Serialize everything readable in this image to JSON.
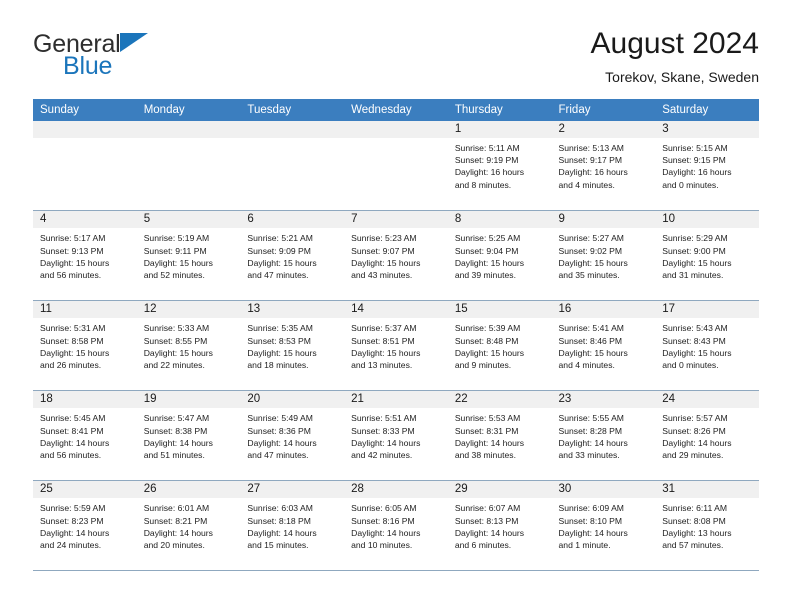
{
  "logo": {
    "line1": "General",
    "line2": "Blue",
    "triangle_color": "#1b75bb",
    "text_color": "#2e2e2e"
  },
  "header": {
    "title": "August 2024",
    "subtitle": "Torekov, Skane, Sweden"
  },
  "theme": {
    "header_bg": "#3b7ebf",
    "header_text": "#ffffff",
    "daynum_bg": "#f0f0f0",
    "cell_border": "#8fa8bf"
  },
  "weekdays": [
    "Sunday",
    "Monday",
    "Tuesday",
    "Wednesday",
    "Thursday",
    "Friday",
    "Saturday"
  ],
  "weeks": [
    [
      {
        "day": "",
        "lines": []
      },
      {
        "day": "",
        "lines": []
      },
      {
        "day": "",
        "lines": []
      },
      {
        "day": "",
        "lines": []
      },
      {
        "day": "1",
        "lines": [
          "Sunrise: 5:11 AM",
          "Sunset: 9:19 PM",
          "Daylight: 16 hours",
          "and 8 minutes."
        ]
      },
      {
        "day": "2",
        "lines": [
          "Sunrise: 5:13 AM",
          "Sunset: 9:17 PM",
          "Daylight: 16 hours",
          "and 4 minutes."
        ]
      },
      {
        "day": "3",
        "lines": [
          "Sunrise: 5:15 AM",
          "Sunset: 9:15 PM",
          "Daylight: 16 hours",
          "and 0 minutes."
        ]
      }
    ],
    [
      {
        "day": "4",
        "lines": [
          "Sunrise: 5:17 AM",
          "Sunset: 9:13 PM",
          "Daylight: 15 hours",
          "and 56 minutes."
        ]
      },
      {
        "day": "5",
        "lines": [
          "Sunrise: 5:19 AM",
          "Sunset: 9:11 PM",
          "Daylight: 15 hours",
          "and 52 minutes."
        ]
      },
      {
        "day": "6",
        "lines": [
          "Sunrise: 5:21 AM",
          "Sunset: 9:09 PM",
          "Daylight: 15 hours",
          "and 47 minutes."
        ]
      },
      {
        "day": "7",
        "lines": [
          "Sunrise: 5:23 AM",
          "Sunset: 9:07 PM",
          "Daylight: 15 hours",
          "and 43 minutes."
        ]
      },
      {
        "day": "8",
        "lines": [
          "Sunrise: 5:25 AM",
          "Sunset: 9:04 PM",
          "Daylight: 15 hours",
          "and 39 minutes."
        ]
      },
      {
        "day": "9",
        "lines": [
          "Sunrise: 5:27 AM",
          "Sunset: 9:02 PM",
          "Daylight: 15 hours",
          "and 35 minutes."
        ]
      },
      {
        "day": "10",
        "lines": [
          "Sunrise: 5:29 AM",
          "Sunset: 9:00 PM",
          "Daylight: 15 hours",
          "and 31 minutes."
        ]
      }
    ],
    [
      {
        "day": "11",
        "lines": [
          "Sunrise: 5:31 AM",
          "Sunset: 8:58 PM",
          "Daylight: 15 hours",
          "and 26 minutes."
        ]
      },
      {
        "day": "12",
        "lines": [
          "Sunrise: 5:33 AM",
          "Sunset: 8:55 PM",
          "Daylight: 15 hours",
          "and 22 minutes."
        ]
      },
      {
        "day": "13",
        "lines": [
          "Sunrise: 5:35 AM",
          "Sunset: 8:53 PM",
          "Daylight: 15 hours",
          "and 18 minutes."
        ]
      },
      {
        "day": "14",
        "lines": [
          "Sunrise: 5:37 AM",
          "Sunset: 8:51 PM",
          "Daylight: 15 hours",
          "and 13 minutes."
        ]
      },
      {
        "day": "15",
        "lines": [
          "Sunrise: 5:39 AM",
          "Sunset: 8:48 PM",
          "Daylight: 15 hours",
          "and 9 minutes."
        ]
      },
      {
        "day": "16",
        "lines": [
          "Sunrise: 5:41 AM",
          "Sunset: 8:46 PM",
          "Daylight: 15 hours",
          "and 4 minutes."
        ]
      },
      {
        "day": "17",
        "lines": [
          "Sunrise: 5:43 AM",
          "Sunset: 8:43 PM",
          "Daylight: 15 hours",
          "and 0 minutes."
        ]
      }
    ],
    [
      {
        "day": "18",
        "lines": [
          "Sunrise: 5:45 AM",
          "Sunset: 8:41 PM",
          "Daylight: 14 hours",
          "and 56 minutes."
        ]
      },
      {
        "day": "19",
        "lines": [
          "Sunrise: 5:47 AM",
          "Sunset: 8:38 PM",
          "Daylight: 14 hours",
          "and 51 minutes."
        ]
      },
      {
        "day": "20",
        "lines": [
          "Sunrise: 5:49 AM",
          "Sunset: 8:36 PM",
          "Daylight: 14 hours",
          "and 47 minutes."
        ]
      },
      {
        "day": "21",
        "lines": [
          "Sunrise: 5:51 AM",
          "Sunset: 8:33 PM",
          "Daylight: 14 hours",
          "and 42 minutes."
        ]
      },
      {
        "day": "22",
        "lines": [
          "Sunrise: 5:53 AM",
          "Sunset: 8:31 PM",
          "Daylight: 14 hours",
          "and 38 minutes."
        ]
      },
      {
        "day": "23",
        "lines": [
          "Sunrise: 5:55 AM",
          "Sunset: 8:28 PM",
          "Daylight: 14 hours",
          "and 33 minutes."
        ]
      },
      {
        "day": "24",
        "lines": [
          "Sunrise: 5:57 AM",
          "Sunset: 8:26 PM",
          "Daylight: 14 hours",
          "and 29 minutes."
        ]
      }
    ],
    [
      {
        "day": "25",
        "lines": [
          "Sunrise: 5:59 AM",
          "Sunset: 8:23 PM",
          "Daylight: 14 hours",
          "and 24 minutes."
        ]
      },
      {
        "day": "26",
        "lines": [
          "Sunrise: 6:01 AM",
          "Sunset: 8:21 PM",
          "Daylight: 14 hours",
          "and 20 minutes."
        ]
      },
      {
        "day": "27",
        "lines": [
          "Sunrise: 6:03 AM",
          "Sunset: 8:18 PM",
          "Daylight: 14 hours",
          "and 15 minutes."
        ]
      },
      {
        "day": "28",
        "lines": [
          "Sunrise: 6:05 AM",
          "Sunset: 8:16 PM",
          "Daylight: 14 hours",
          "and 10 minutes."
        ]
      },
      {
        "day": "29",
        "lines": [
          "Sunrise: 6:07 AM",
          "Sunset: 8:13 PM",
          "Daylight: 14 hours",
          "and 6 minutes."
        ]
      },
      {
        "day": "30",
        "lines": [
          "Sunrise: 6:09 AM",
          "Sunset: 8:10 PM",
          "Daylight: 14 hours",
          "and 1 minute."
        ]
      },
      {
        "day": "31",
        "lines": [
          "Sunrise: 6:11 AM",
          "Sunset: 8:08 PM",
          "Daylight: 13 hours",
          "and 57 minutes."
        ]
      }
    ]
  ]
}
